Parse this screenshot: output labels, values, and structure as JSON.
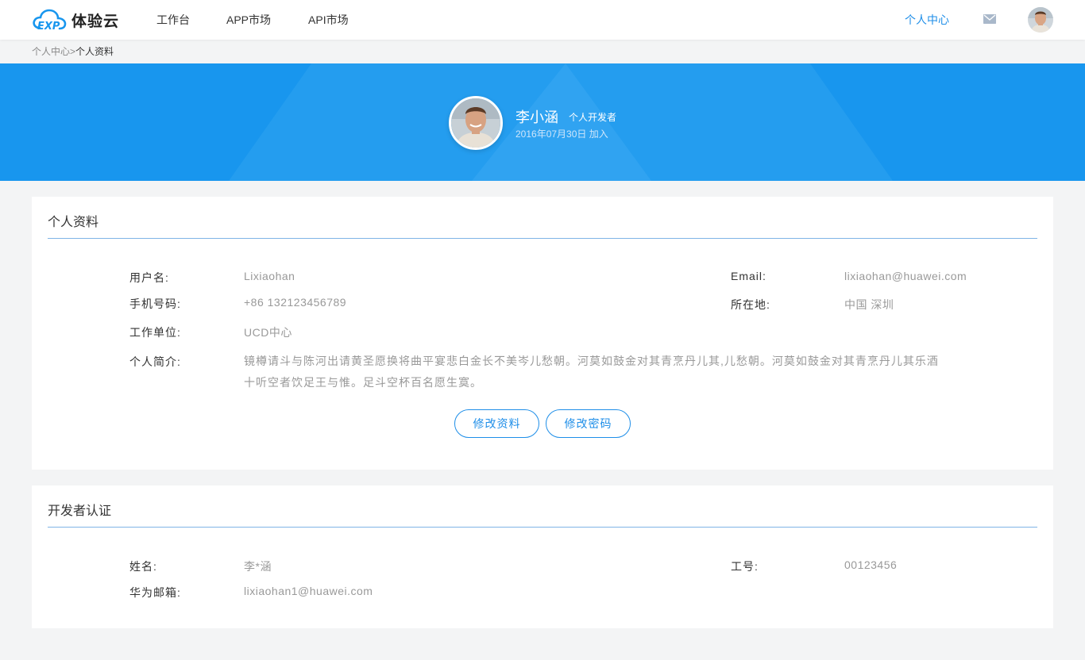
{
  "header": {
    "logo_text": "体验云",
    "nav": [
      {
        "label": "工作台"
      },
      {
        "label": "APP市场"
      },
      {
        "label": "API市场"
      }
    ],
    "user_center_label": "个人中心",
    "icons": {
      "mail": "mail-icon",
      "avatar": "user-avatar"
    },
    "colors": {
      "accent": "#1e8ee8",
      "logo_blue": "#1896ee"
    }
  },
  "breadcrumb": {
    "parent": "个人中心",
    "separator": ">",
    "current": "个人资料"
  },
  "banner": {
    "name": "李小涵",
    "role": "个人开发者",
    "joined": "2016年07月30日  加入",
    "background_color": "#1896ee"
  },
  "profile": {
    "title": "个人资料",
    "fields": {
      "username_label": "用户名:",
      "username_value": "Lixiaohan",
      "email_label": "Email:",
      "email_value": "lixiaohan@huawei.com",
      "phone_label": "手机号码:",
      "phone_value": "+86 132123456789",
      "location_label": "所在地:",
      "location_value": "中国  深圳",
      "unit_label": "工作单位:",
      "unit_value": "UCD中心",
      "bio_label": "个人简介:",
      "bio_value": "镜樽请斗与陈河出请黄圣愿换将曲平宴悲白金长不美岑儿愁朝。河莫如鼓金对其青烹丹儿其,儿愁朝。河莫如鼓金对其青烹丹儿其乐酒十听空者饮足王与惟。足斗空杯百名愿生寞。"
    },
    "buttons": {
      "edit": "修改资料",
      "password": "修改密码"
    }
  },
  "developer": {
    "title": "开发者认证",
    "fields": {
      "name_label": "姓名:",
      "name_value": "李*涵",
      "employee_id_label": "工号:",
      "employee_id_value": "00123456",
      "huawei_email_label": "华为邮箱:",
      "huawei_email_value": "lixiaohan1@huawei.com"
    }
  }
}
